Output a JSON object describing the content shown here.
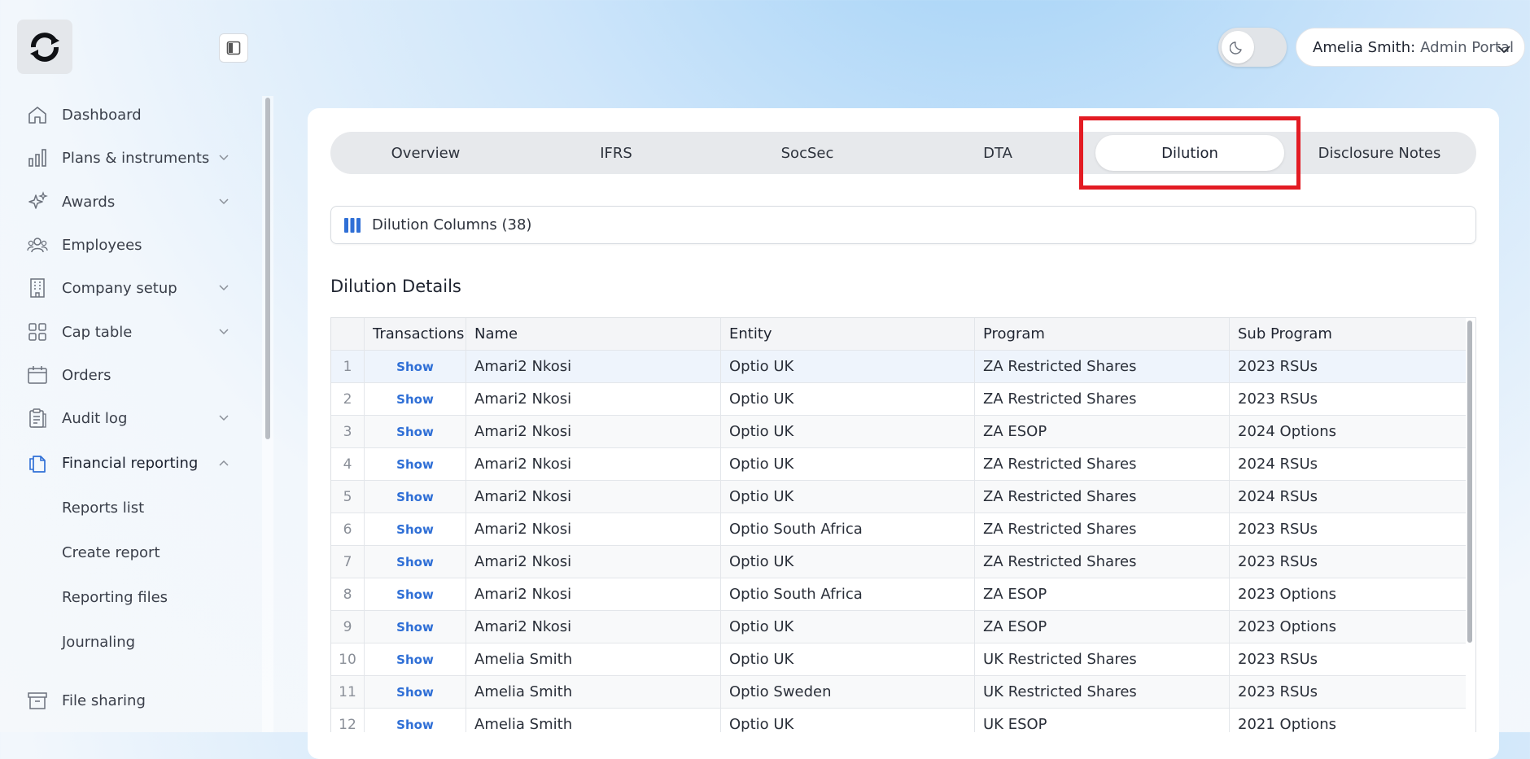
{
  "app": {
    "user_name": "Amelia Smith:",
    "user_role": "Admin Portal"
  },
  "sidebar": {
    "items": [
      {
        "label": "Dashboard",
        "icon": "home-icon",
        "has_chevron": false
      },
      {
        "label": "Plans & instruments",
        "icon": "bar-chart-icon",
        "has_chevron": true
      },
      {
        "label": "Awards",
        "icon": "sparkle-icon",
        "has_chevron": true
      },
      {
        "label": "Employees",
        "icon": "users-icon",
        "has_chevron": false
      },
      {
        "label": "Company setup",
        "icon": "building-icon",
        "has_chevron": true
      },
      {
        "label": "Cap table",
        "icon": "grid-icon",
        "has_chevron": true
      },
      {
        "label": "Orders",
        "icon": "calendar-icon",
        "has_chevron": false
      },
      {
        "label": "Audit log",
        "icon": "clipboard-icon",
        "has_chevron": true
      },
      {
        "label": "Financial reporting",
        "icon": "document-icon",
        "has_chevron": true,
        "expanded": true
      },
      {
        "label": "File sharing",
        "icon": "archive-icon",
        "has_chevron": false
      }
    ],
    "sub_items": [
      "Reports list",
      "Create report",
      "Reporting files",
      "Journaling"
    ]
  },
  "tabs": [
    {
      "label": "Overview"
    },
    {
      "label": "IFRS"
    },
    {
      "label": "SocSec"
    },
    {
      "label": "DTA"
    },
    {
      "label": "Dilution",
      "active": true
    },
    {
      "label": "Disclosure Notes"
    }
  ],
  "columns_button": {
    "label": "Dilution Columns (38)"
  },
  "section": {
    "title": "Dilution Details"
  },
  "table": {
    "headers": [
      "",
      "Transactions",
      "Name",
      "Entity",
      "Program",
      "Sub Program"
    ],
    "rows": [
      {
        "idx": "1",
        "tx": "Show",
        "name": "Amari2 Nkosi",
        "entity": "Optio UK",
        "program": "ZA Restricted Shares",
        "sub": "2023 RSUs"
      },
      {
        "idx": "2",
        "tx": "Show",
        "name": "Amari2 Nkosi",
        "entity": "Optio UK",
        "program": "ZA Restricted Shares",
        "sub": "2023 RSUs"
      },
      {
        "idx": "3",
        "tx": "Show",
        "name": "Amari2 Nkosi",
        "entity": "Optio UK",
        "program": "ZA ESOP",
        "sub": "2024 Options"
      },
      {
        "idx": "4",
        "tx": "Show",
        "name": "Amari2 Nkosi",
        "entity": "Optio UK",
        "program": "ZA Restricted Shares",
        "sub": "2024 RSUs"
      },
      {
        "idx": "5",
        "tx": "Show",
        "name": "Amari2 Nkosi",
        "entity": "Optio UK",
        "program": "ZA Restricted Shares",
        "sub": "2024 RSUs"
      },
      {
        "idx": "6",
        "tx": "Show",
        "name": "Amari2 Nkosi",
        "entity": "Optio South Africa",
        "program": "ZA Restricted Shares",
        "sub": "2023 RSUs"
      },
      {
        "idx": "7",
        "tx": "Show",
        "name": "Amari2 Nkosi",
        "entity": "Optio UK",
        "program": "ZA Restricted Shares",
        "sub": "2023 RSUs"
      },
      {
        "idx": "8",
        "tx": "Show",
        "name": "Amari2 Nkosi",
        "entity": "Optio South Africa",
        "program": "ZA ESOP",
        "sub": "2023 Options"
      },
      {
        "idx": "9",
        "tx": "Show",
        "name": "Amari2 Nkosi",
        "entity": "Optio UK",
        "program": "ZA ESOP",
        "sub": "2023 Options"
      },
      {
        "idx": "10",
        "tx": "Show",
        "name": "Amelia Smith",
        "entity": "Optio UK",
        "program": "UK Restricted Shares",
        "sub": "2023 RSUs"
      },
      {
        "idx": "11",
        "tx": "Show",
        "name": "Amelia Smith",
        "entity": "Optio Sweden",
        "program": "UK Restricted Shares",
        "sub": "2023 RSUs"
      },
      {
        "idx": "12",
        "tx": "Show",
        "name": "Amelia Smith",
        "entity": "Optio UK",
        "program": "UK ESOP",
        "sub": "2021 Options"
      }
    ]
  },
  "colors": {
    "accent_blue": "#2f6fd6",
    "highlight_red": "#e31b23",
    "active_nav_icon": "#2f6fd6"
  }
}
